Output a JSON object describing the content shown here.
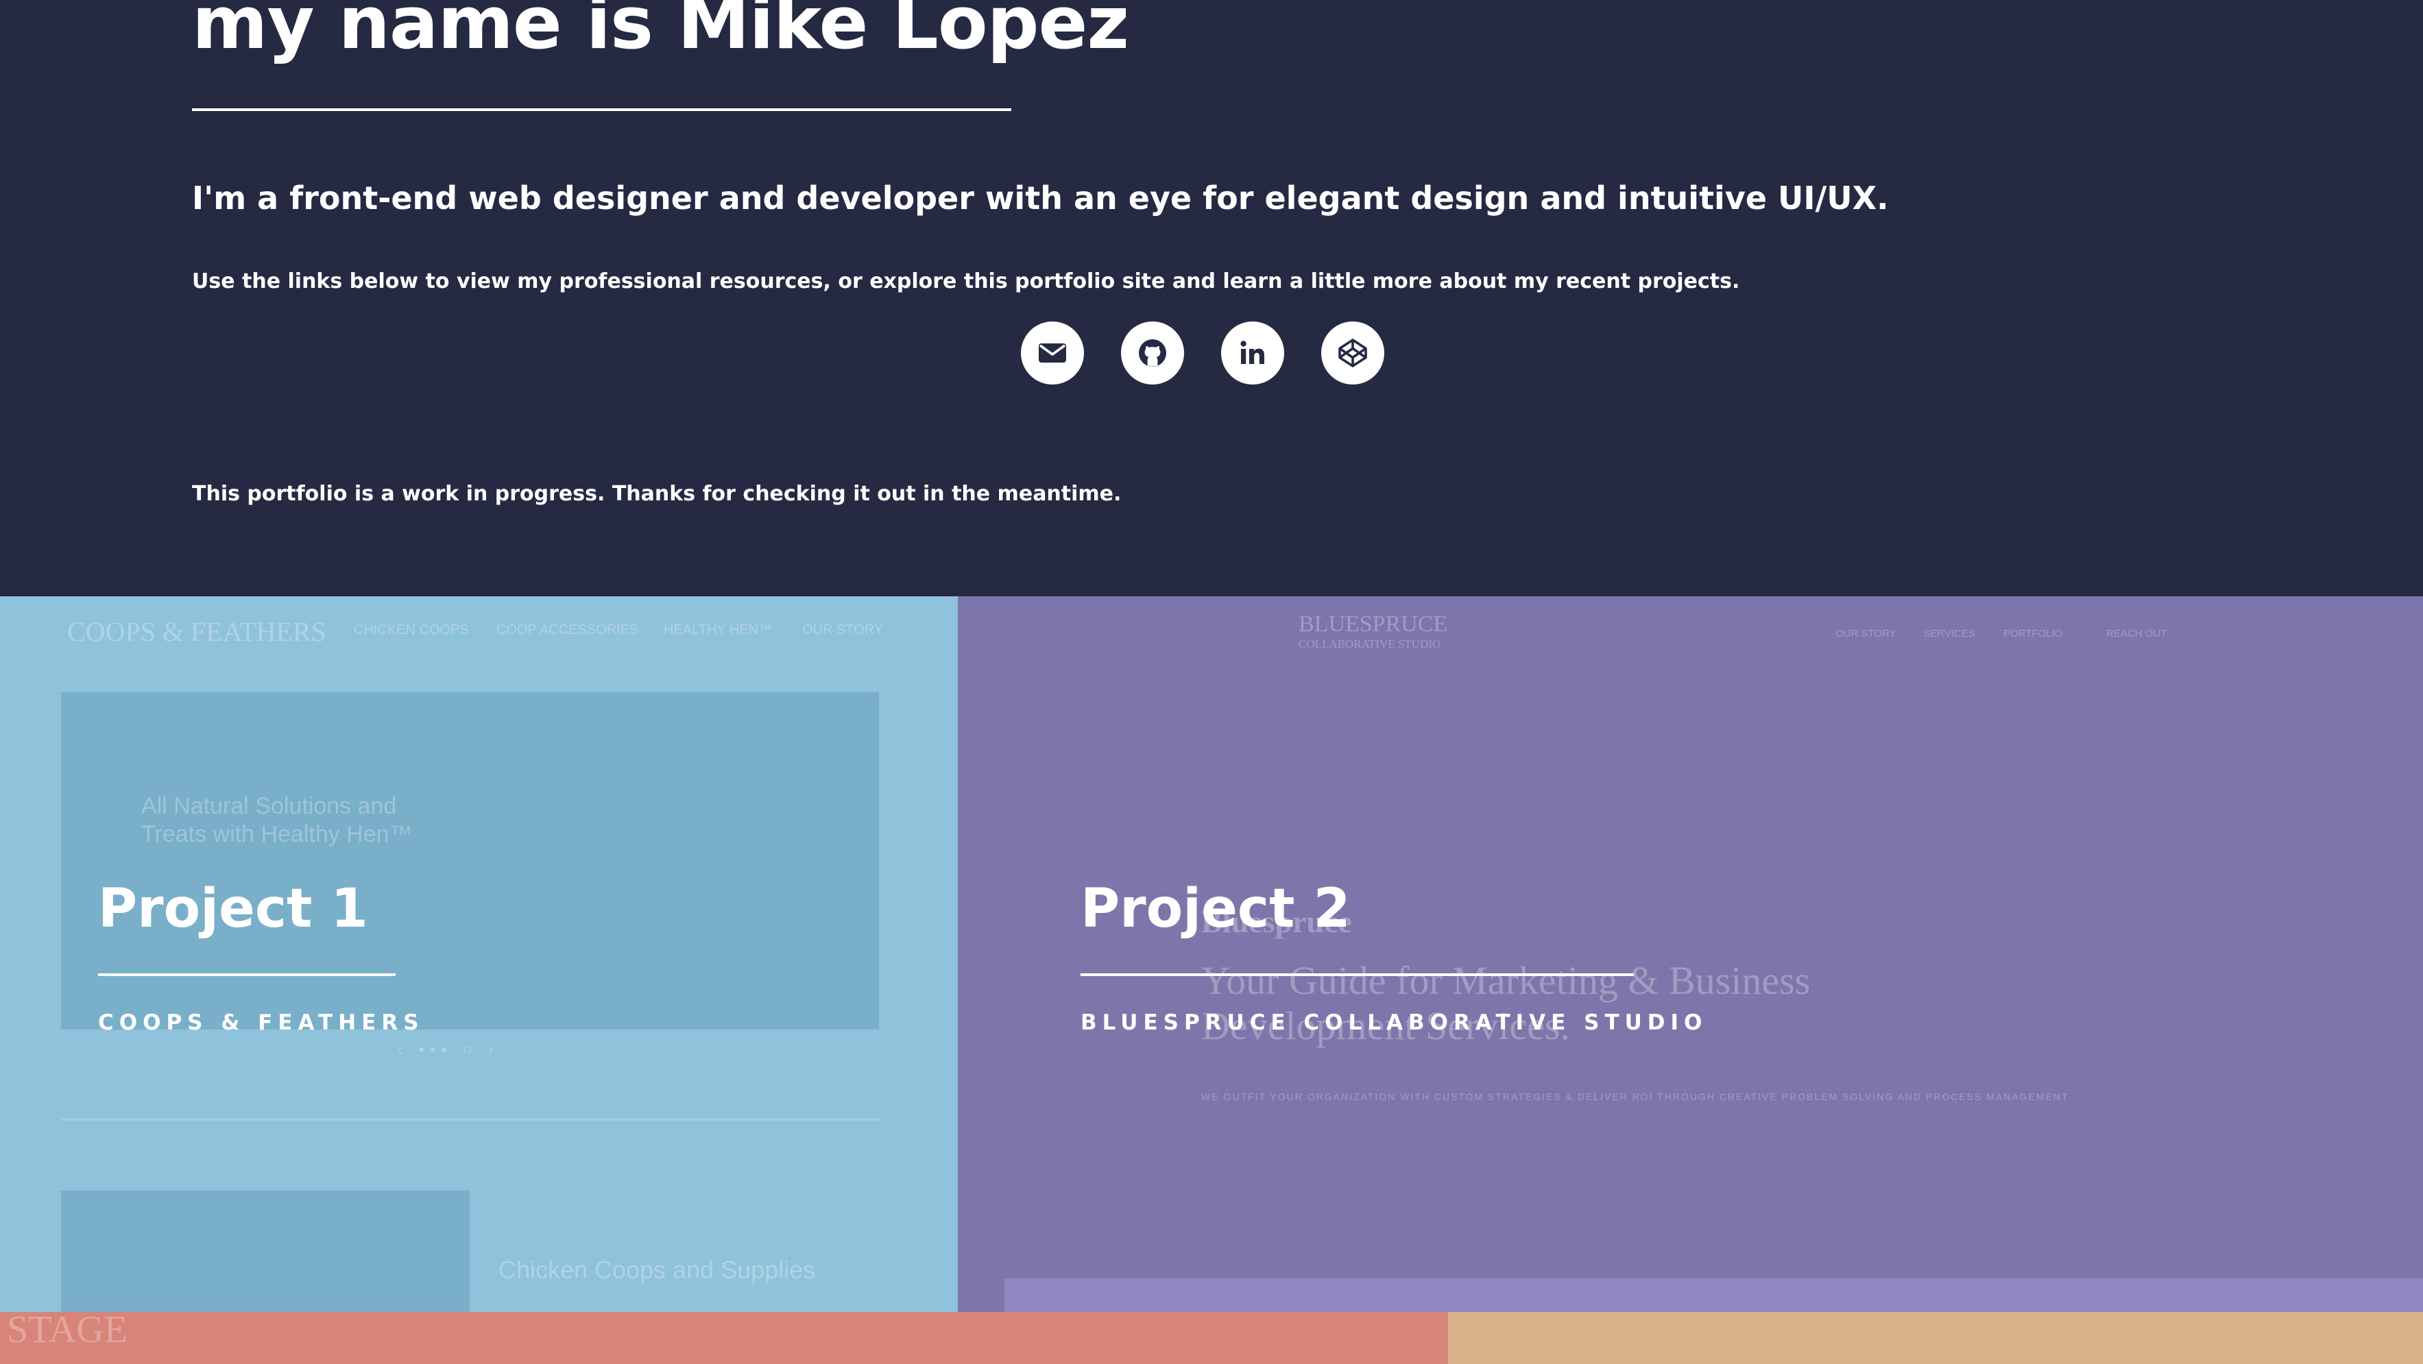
{
  "hero": {
    "title": "my name is Mike Lopez",
    "tagline": "I'm a front-end web designer and developer with an eye for elegant design and intuitive UI/UX.",
    "intro": "Use the links below to view my professional resources, or explore this portfolio site and learn a little more about my recent projects.",
    "note": "This portfolio is a work in progress. Thanks for checking it out in the meantime."
  },
  "social": [
    {
      "name": "email",
      "icon": "envelope-icon"
    },
    {
      "name": "github",
      "icon": "github-icon"
    },
    {
      "name": "linkedin",
      "icon": "linkedin-icon"
    },
    {
      "name": "codepen",
      "icon": "codepen-icon"
    }
  ],
  "projects": [
    {
      "title": "Project 1",
      "subtitle": "COOPS & FEATHERS",
      "color": "#8fc2db",
      "preview": {
        "logo": "COOPS & FEATHERS",
        "nav": [
          "CHICKEN COOPS",
          "COOP ACCESSORIES",
          "HEALTHY HEN™",
          "OUR STORY"
        ],
        "banner_text": "All Natural Solutions and Treats with Healthy Hen™",
        "section_heading": "Chicken Coops and Supplies"
      }
    },
    {
      "title": "Project 2",
      "subtitle": "BLUESPRUCE COLLABORATIVE STUDIO",
      "color": "#7d76ab",
      "preview": {
        "logo": "BLUESPRUCE",
        "logo_sub": "COLLABORATIVE STUDIO",
        "nav": [
          "OUR STORY",
          "SERVICES",
          "PORTFOLIO",
          "REACH OUT"
        ],
        "kicker": "Bluespruce",
        "headline": "Your Guide for Marketing & Business Development Services.",
        "body": "WE OUTFIT YOUR ORGANIZATION WITH CUSTOM STRATEGIES & DELIVER ROI THROUGH CREATIVE PROBLEM SOLVING AND PROCESS MANAGEMENT"
      }
    },
    {
      "color": "#d88479",
      "preview": {
        "logo": "STAGE"
      }
    },
    {
      "color": "#d9b189"
    }
  ]
}
